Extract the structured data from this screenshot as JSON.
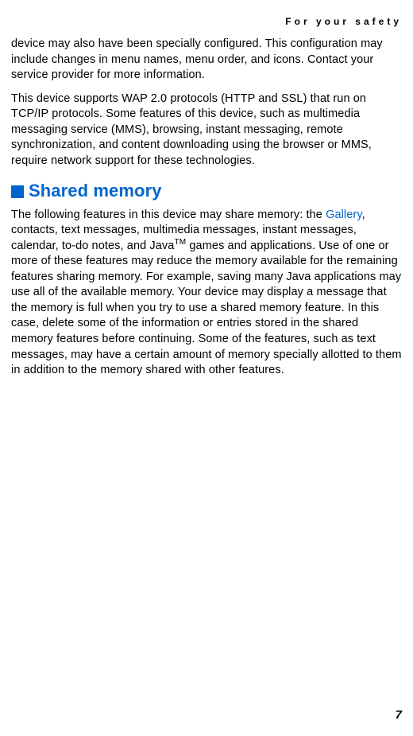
{
  "header": {
    "title": "For your safety"
  },
  "content": {
    "paragraph1": "device may also have been specially configured. This configuration may include changes in menu names, menu order, and icons. Contact your service provider for more information.",
    "paragraph2": "This device supports WAP 2.0 protocols (HTTP and SSL) that run on TCP/IP protocols. Some features of this device, such as multimedia messaging service (MMS), browsing, instant messaging, remote synchronization, and content downloading using the browser or MMS, require network support for these technologies.",
    "section": {
      "title": "Shared memory",
      "body_before_link": "The following features in this device may share memory: the ",
      "link_text": "Gallery",
      "body_after_link_before_tm": ", contacts, text messages, multimedia messages, instant messages, calendar, to-do notes, and Java",
      "tm": "TM",
      "body_after_tm": " games and applications. Use of one or more of these features may reduce the memory available for the remaining features sharing memory. For example, saving many Java applications may use all of the available memory. Your device may display a message that the memory is full when you try to use a shared memory feature. In this case, delete some of the information or entries stored in the shared memory features before continuing. Some of the features, such as text messages, may have a certain amount of memory specially allotted to them in addition to the memory shared with other features."
    }
  },
  "footer": {
    "page_number": "7"
  }
}
